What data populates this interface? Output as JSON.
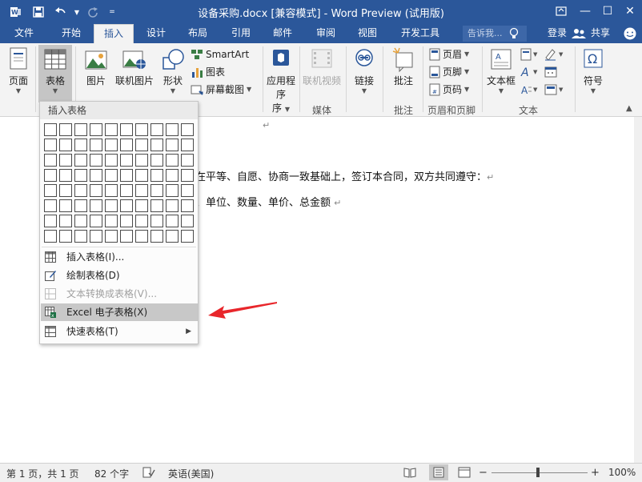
{
  "titlebar": {
    "title": "设备采购.docx [兼容模式] - Word Preview (试用版)",
    "bg": "#2b579a"
  },
  "tabs": {
    "items": [
      "文件",
      "开始",
      "插入",
      "设计",
      "布局",
      "引用",
      "邮件",
      "审阅",
      "视图",
      "开发工具"
    ],
    "active": "插入",
    "tell_me": "告诉我...",
    "login": "登录",
    "share": "共享"
  },
  "ribbon": {
    "page": "页面",
    "table": "表格",
    "picture": "图片",
    "online_picture": "联机图片",
    "shapes": "形状",
    "smartart": "SmartArt",
    "chart": "图表",
    "screenshot": "屏幕截图",
    "apps": "应用程序",
    "apps_sub": "序",
    "online_video": "联机视频",
    "link": "链接",
    "comment": "批注",
    "header": "页眉",
    "footer": "页脚",
    "page_number": "页码",
    "textbox": "文本框",
    "symbol": "符号",
    "groups": {
      "media": "媒体",
      "comments": "批注",
      "header_footer": "页眉和页脚",
      "text": "文本"
    }
  },
  "document": {
    "line1": "在平等、自愿、协商一致基础上，签订本合同，双方共同遵守：",
    "line2": "、单位、数量、单价、总金额",
    "para_mark": "↵"
  },
  "dropdown": {
    "header": "插入表格",
    "grid_cols": 10,
    "grid_rows": 8,
    "items": [
      {
        "label": "插入表格(I)...",
        "enabled": true,
        "highlighted": false,
        "submenu": false
      },
      {
        "label": "绘制表格(D)",
        "enabled": true,
        "highlighted": false,
        "submenu": false
      },
      {
        "label": "文本转换成表格(V)...",
        "enabled": false,
        "highlighted": false,
        "submenu": false
      },
      {
        "label": "Excel 电子表格(X)",
        "enabled": true,
        "highlighted": true,
        "submenu": false
      },
      {
        "label": "快速表格(T)",
        "enabled": true,
        "highlighted": false,
        "submenu": true
      }
    ]
  },
  "status": {
    "page": "第 1 页，共 1 页",
    "words": "82 个字",
    "language": "英语(美国)",
    "zoom": "100%"
  },
  "colors": {
    "accent": "#2b579a",
    "annotation_arrow": "#e8262b"
  }
}
